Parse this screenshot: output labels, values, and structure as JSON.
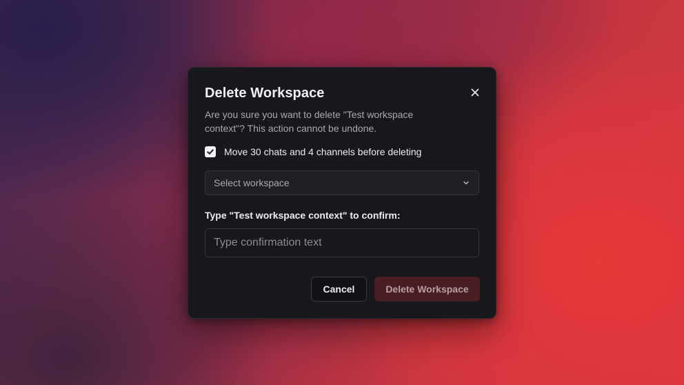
{
  "dialog": {
    "title": "Delete Workspace",
    "close_icon": "close-icon",
    "description": "Are you sure you want to delete \"Test workspace context\"? This action cannot be undone.",
    "move_option": {
      "checked": true,
      "label": "Move 30 chats and 4 channels before deleting"
    },
    "workspace_select": {
      "selected_text": "Select workspace",
      "icon": "chevron-down-icon"
    },
    "confirm": {
      "label_prefix": "Type ",
      "label_target": "\"Test workspace context\"",
      "label_suffix": " to confirm:",
      "placeholder": "Type confirmation text",
      "value": ""
    },
    "buttons": {
      "cancel": "Cancel",
      "delete": "Delete Workspace"
    }
  },
  "colors": {
    "dialog_bg": "#18181c",
    "delete_button_bg": "#4a1d22",
    "text_primary": "#ededf0",
    "text_muted": "#a9a9b1"
  }
}
